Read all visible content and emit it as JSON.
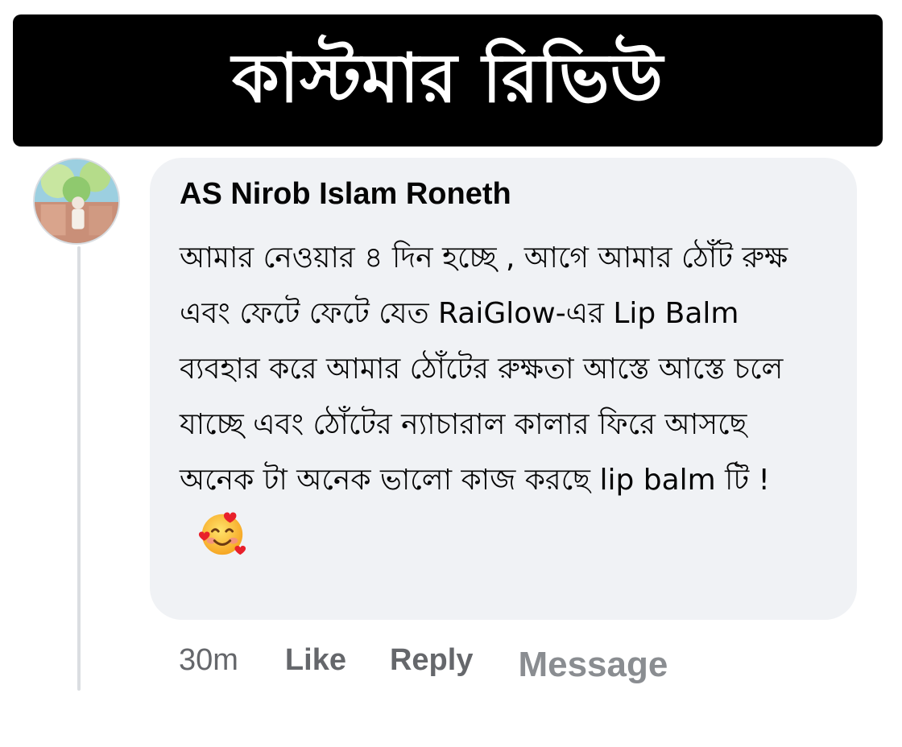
{
  "banner": {
    "title": "কাস্টমার রিভিউ"
  },
  "comment": {
    "author": "AS Nirob Islam Roneth",
    "text": "আমার নেওয়ার ৪ দিন হচ্ছে , আগে আমার ঠোঁট রুক্ষ এবং ফেটে ফেটে যেত RaiGlow-এর Lip Balm ব্যবহার করে আমার ঠোঁটের রুক্ষতা আস্তে আস্তে চলে যাচ্ছে এবং ঠোঁটের ন্যাচারাল কালার ফিরে আসছে অনেক টা অনেক ভালো কাজ করছে lip balm টি !",
    "emoji": "smiling-face-with-hearts-icon",
    "time": "30m",
    "like_label": "Like",
    "reply_label": "Reply",
    "message_label": "Message"
  },
  "colors": {
    "banner_bg": "#000000",
    "bubble_bg": "#f0f2f5",
    "meta_text": "#65676b",
    "message_text": "#8a8d91"
  }
}
